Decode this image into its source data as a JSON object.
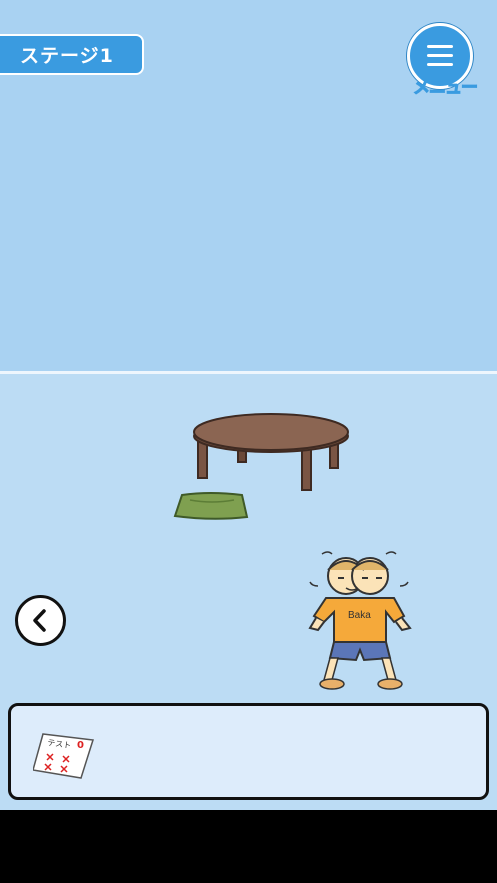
{
  "header": {
    "stage_label": "ステージ1",
    "menu_label": "メニュー"
  },
  "scene": {
    "character_shirt_text": "Baka"
  },
  "icons": {
    "menu": "hamburger-menu-icon",
    "back": "chevron-left-icon",
    "inventory_item": "test-paper-icon"
  },
  "inventory": {
    "items": [
      {
        "name": "test-paper",
        "title_text": "テスト",
        "score_text": "0"
      }
    ]
  },
  "colors": {
    "wall": "#a9d2f2",
    "floor": "#bcdcf4",
    "accent": "#3a9be0",
    "inventory_bg": "#ddecfb"
  }
}
